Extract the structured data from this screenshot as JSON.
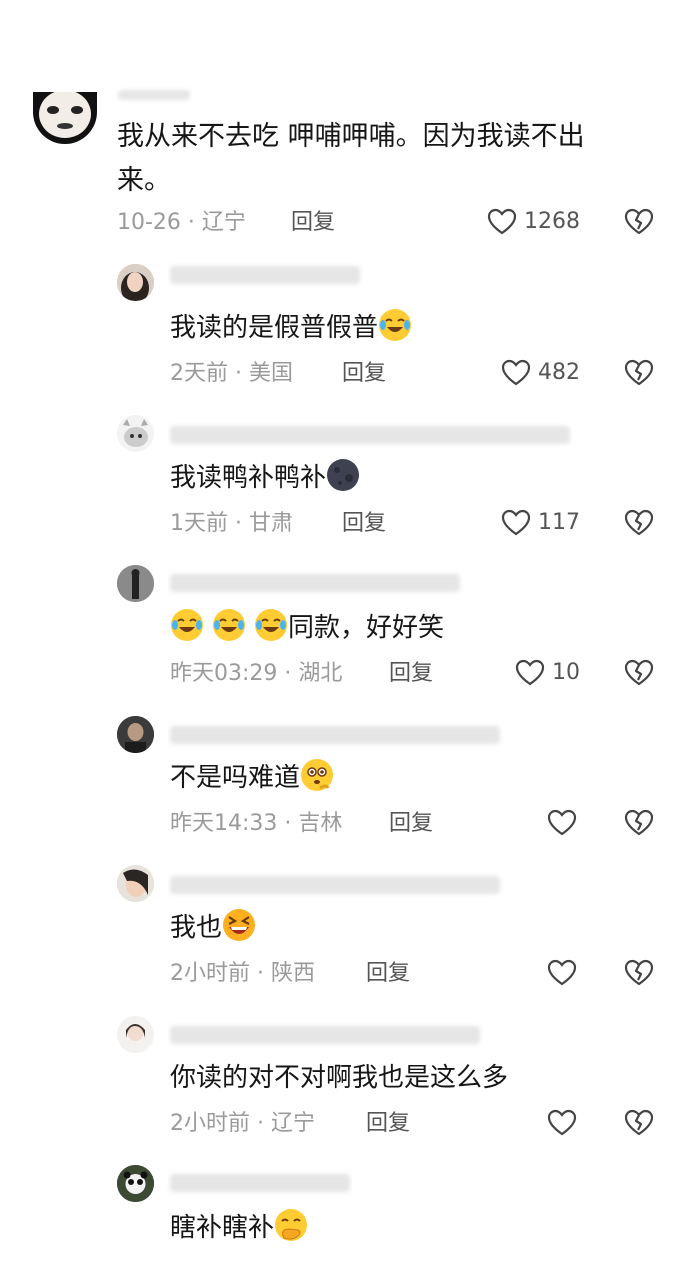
{
  "comments": [
    {
      "text_line1": "我从来不去吃 呷哺呷哺。因为我读不出",
      "text_line2": "来。",
      "meta": "10-26 · 辽宁",
      "reply": "回复",
      "likes": "1268"
    }
  ],
  "replies": [
    {
      "text": "我读的是假普假普",
      "emoji": "crying-laugh-emoji",
      "meta": "2天前 · 美国",
      "reply": "回复",
      "likes": "482"
    },
    {
      "text": "我读鸭补鸭补",
      "emoji": "dark-moon-emoji",
      "meta": "1天前 · 甘肃",
      "reply": "回复",
      "likes": "117"
    },
    {
      "text": "同款，好好笑",
      "emoji": "crying-laugh-emoji",
      "meta": "昨天03:29 · 湖北",
      "reply": "回复",
      "likes": "10"
    },
    {
      "text": "不是吗难道",
      "emoji": "thinking-emoji",
      "meta": "昨天14:33 · 吉林",
      "reply": "回复",
      "likes": ""
    },
    {
      "text": "我也",
      "emoji": "grinning-squint-emoji",
      "meta": "2小时前 · 陕西",
      "reply": "回复",
      "likes": ""
    },
    {
      "text": "你读的对不对啊我也是这么多",
      "emoji": "",
      "meta": "2小时前 · 辽宁",
      "reply": "回复",
      "likes": ""
    },
    {
      "text": "瞎补瞎补",
      "emoji": "hand-over-mouth-emoji",
      "meta": "",
      "reply": "",
      "likes": ""
    }
  ]
}
